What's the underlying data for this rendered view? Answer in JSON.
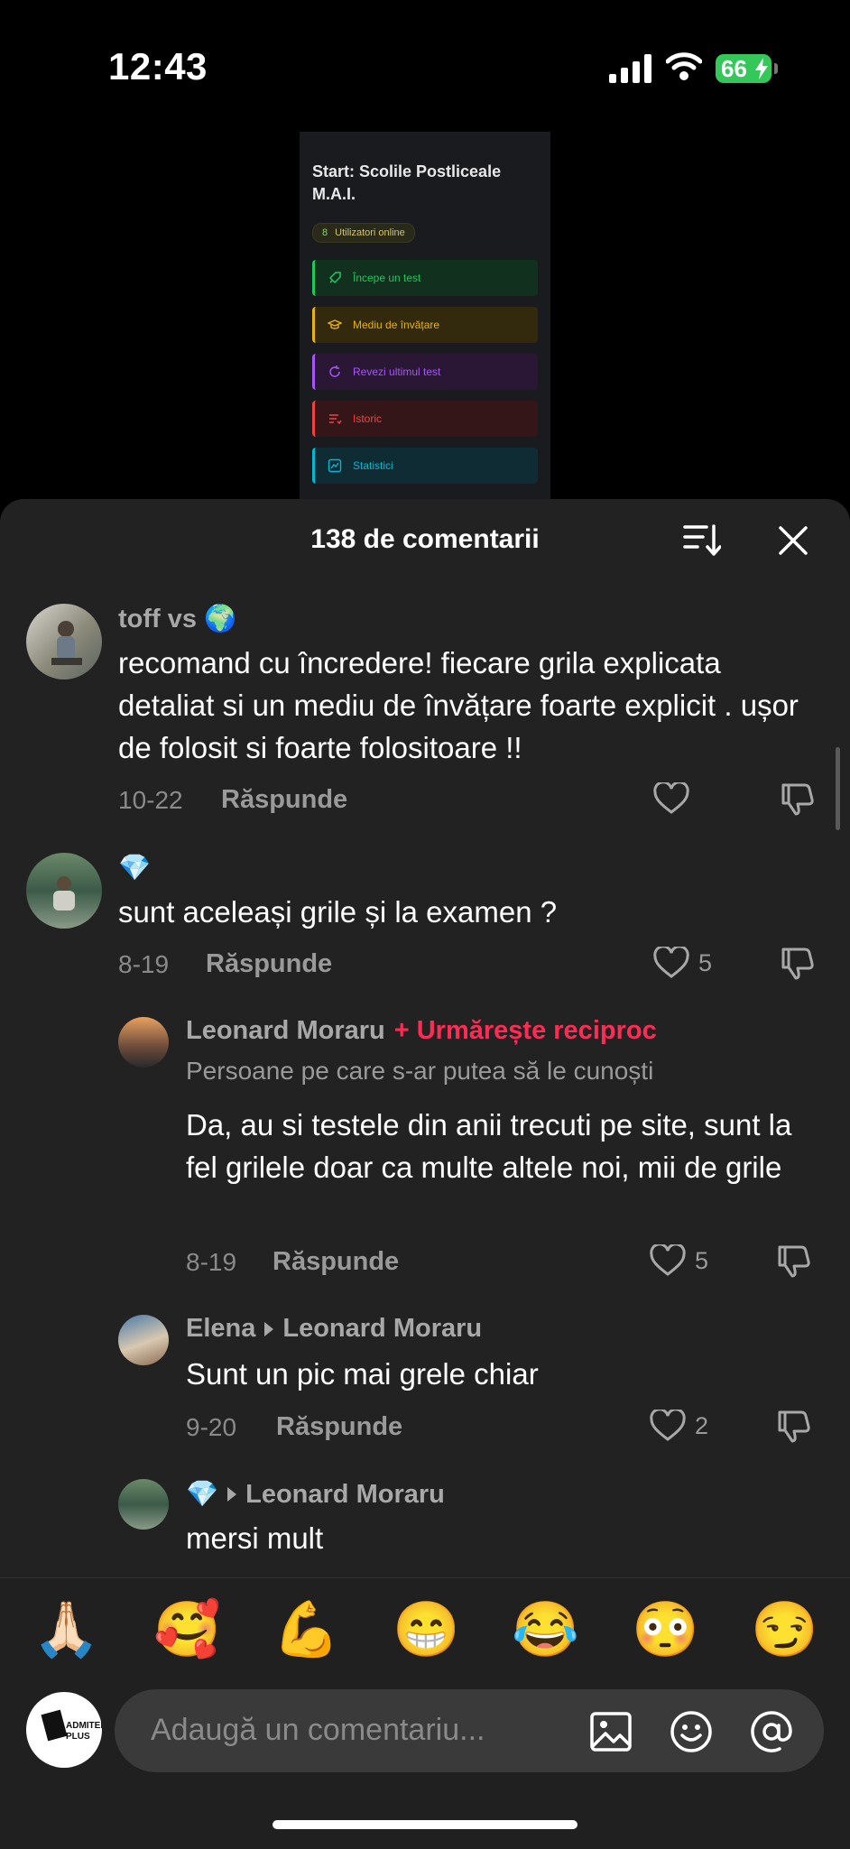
{
  "status": {
    "time": "12:43",
    "battery": "66"
  },
  "preview": {
    "title": "Start: Scolile Postliceale M.A.I.",
    "online_count": "8",
    "online_label": "Utilizatori online",
    "items": [
      {
        "label": "Începe un test",
        "color": "#22c55e",
        "bg": "#11301d"
      },
      {
        "label": "Mediu de învățare",
        "color": "#eab308",
        "bg": "#33290c"
      },
      {
        "label": "Revezi ultimul test",
        "color": "#a855f7",
        "bg": "#2a1736"
      },
      {
        "label": "Istoric",
        "color": "#ef4444",
        "bg": "#351618"
      },
      {
        "label": "Statistici",
        "color": "#06b6d4",
        "bg": "#0f2b33"
      }
    ]
  },
  "sheet": {
    "title": "138 de comentarii"
  },
  "comments": [
    {
      "username": "toff vs 🌍",
      "text": "recomand cu încredere! fiecare grila explicata detaliat si un mediu de învățare foarte explicit . ușor de folosit si foarte folositoare !!",
      "date": "10-22",
      "reply": "Răspunde",
      "likes": ""
    },
    {
      "username": "💎",
      "text": "sunt aceleași grile și la examen ?",
      "date": "8-19",
      "reply": "Răspunde",
      "likes": "5"
    }
  ],
  "replies": [
    {
      "username": "Leonard Moraru",
      "follow": "+ Urmărește reciproc",
      "note": "Persoane pe care s-ar putea să le cunoști",
      "text": "Da, au si testele din anii trecuti pe site, sunt la fel grilele doar ca multe altele noi, mii de grile",
      "date": "8-19",
      "reply": "Răspunde",
      "likes": "5"
    },
    {
      "username": "Elena",
      "reply_to": "Leonard Moraru",
      "text": "Sunt un pic mai grele chiar",
      "date": "9-20",
      "reply": "Răspunde",
      "likes": "2"
    },
    {
      "username": "💎",
      "reply_to": "Leonard Moraru",
      "text": "mersi mult"
    }
  ],
  "emojis": [
    "🙏🏻",
    "🥰",
    "💪",
    "😁",
    "😂",
    "😳",
    "😏"
  ],
  "composer": {
    "placeholder": "Adaugă un comentariu...",
    "avatar_text": "ADMITERE PLUS"
  }
}
